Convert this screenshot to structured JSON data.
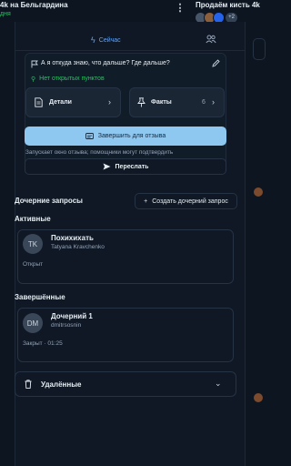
{
  "header": {
    "title": "4k на Бельгардина",
    "subtitle": "дня",
    "right_title": "Продаём кисть 4k",
    "participants_more": "+2"
  },
  "tabs": {
    "now_label": "Сейчас"
  },
  "question": {
    "text": "А я откуда знаю, что дальше? Где дальше?",
    "open_points": "Нет открытых пунктов"
  },
  "tiles": {
    "details_label": "Детали",
    "facts_label": "Факты",
    "facts_count": "6"
  },
  "actions": {
    "finish_label": "Завершить для отзыва",
    "finish_hint": "Запускает окно отзыва; помощники могут подтвердить",
    "forward_label": "Переслать"
  },
  "child_requests": {
    "title": "Дочерние запросы",
    "create_label": "Создать дочерний запрос",
    "active_title": "Активные",
    "active": [
      {
        "initials": "TK",
        "title": "Похихихать",
        "user": "Tatyana Kravchenko",
        "status": "Открыт"
      }
    ],
    "finished_title": "Завершённые",
    "finished": [
      {
        "initials": "DM",
        "title": "Дочерний 1",
        "user": "dmitrsosnin",
        "status": "Закрыт · 01:25"
      }
    ],
    "deleted_label": "Удалённые"
  },
  "colors": {
    "accent": "#60a5fa",
    "primary_button": "#8ec8f0",
    "success": "#22c55e",
    "background": "#0d1520"
  }
}
